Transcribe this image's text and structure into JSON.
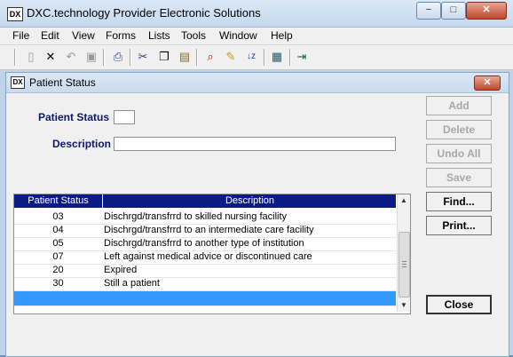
{
  "app": {
    "title": "DXC.technology Provider Electronic Solutions",
    "icon_text": "DX",
    "window_buttons": {
      "minimize": "−",
      "maximize": "□",
      "close": "✕"
    }
  },
  "menu": {
    "items": [
      "File",
      "Edit",
      "View",
      "Forms",
      "Lists",
      "Tools",
      "Window",
      "Help"
    ]
  },
  "toolbar": {
    "icons": [
      "new-icon",
      "delete-icon",
      "undo-icon",
      "save-icon",
      "print-icon",
      "cut-icon",
      "copy-icon",
      "paste-icon",
      "find-icon",
      "tools-icon",
      "sort-icon",
      "calculator-icon",
      "exit-icon"
    ]
  },
  "child_window": {
    "title": "Patient Status",
    "icon_text": "DX",
    "close_glyph": "✕"
  },
  "form": {
    "patient_status_label": "Patient Status",
    "patient_status_value": "",
    "description_label": "Description",
    "description_value": ""
  },
  "buttons": {
    "add": "Add",
    "delete": "Delete",
    "undo_all": "Undo All",
    "save": "Save",
    "find": "Find...",
    "print": "Print...",
    "close": "Close"
  },
  "grid": {
    "headers": [
      "Patient Status",
      "Description"
    ],
    "rows": [
      {
        "code": "03",
        "description": "Dischrgd/transfrrd to skilled nursing facility"
      },
      {
        "code": "04",
        "description": "Dischrgd/transfrrd to an intermediate care facility"
      },
      {
        "code": "05",
        "description": "Dischrgd/transfrrd to another type of institution"
      },
      {
        "code": "07",
        "description": "Left against medical advice or discontinued care"
      },
      {
        "code": "20",
        "description": "Expired"
      },
      {
        "code": "30",
        "description": "Still a patient"
      }
    ],
    "selected_row": {
      "code": "",
      "description": ""
    }
  },
  "colors": {
    "header_bg": "#0b1a84",
    "selection": "#3399ff",
    "label": "#0a1a6a"
  }
}
